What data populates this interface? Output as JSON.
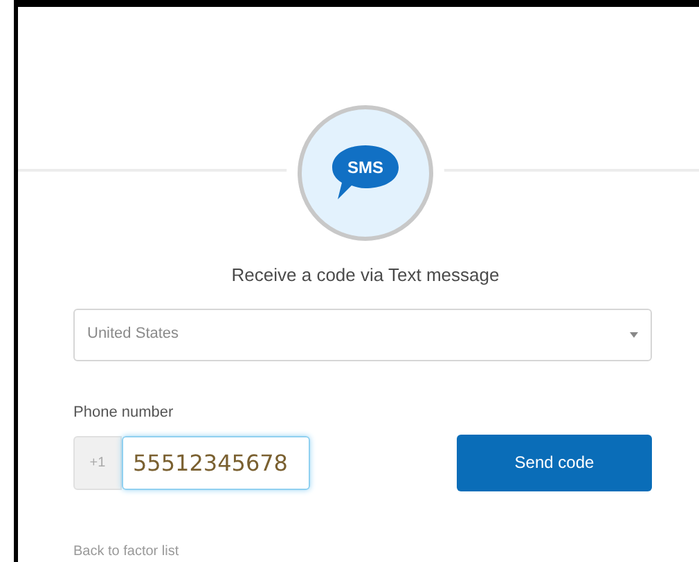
{
  "badge": {
    "text": "SMS"
  },
  "title": "Receive a code via Text message",
  "country_select": {
    "value": "United States"
  },
  "phone": {
    "label": "Phone number",
    "prefix": "+1",
    "value": "55512345678",
    "focused": true
  },
  "send_button": {
    "label": "Send code"
  },
  "back_link": "Back to factor list"
}
